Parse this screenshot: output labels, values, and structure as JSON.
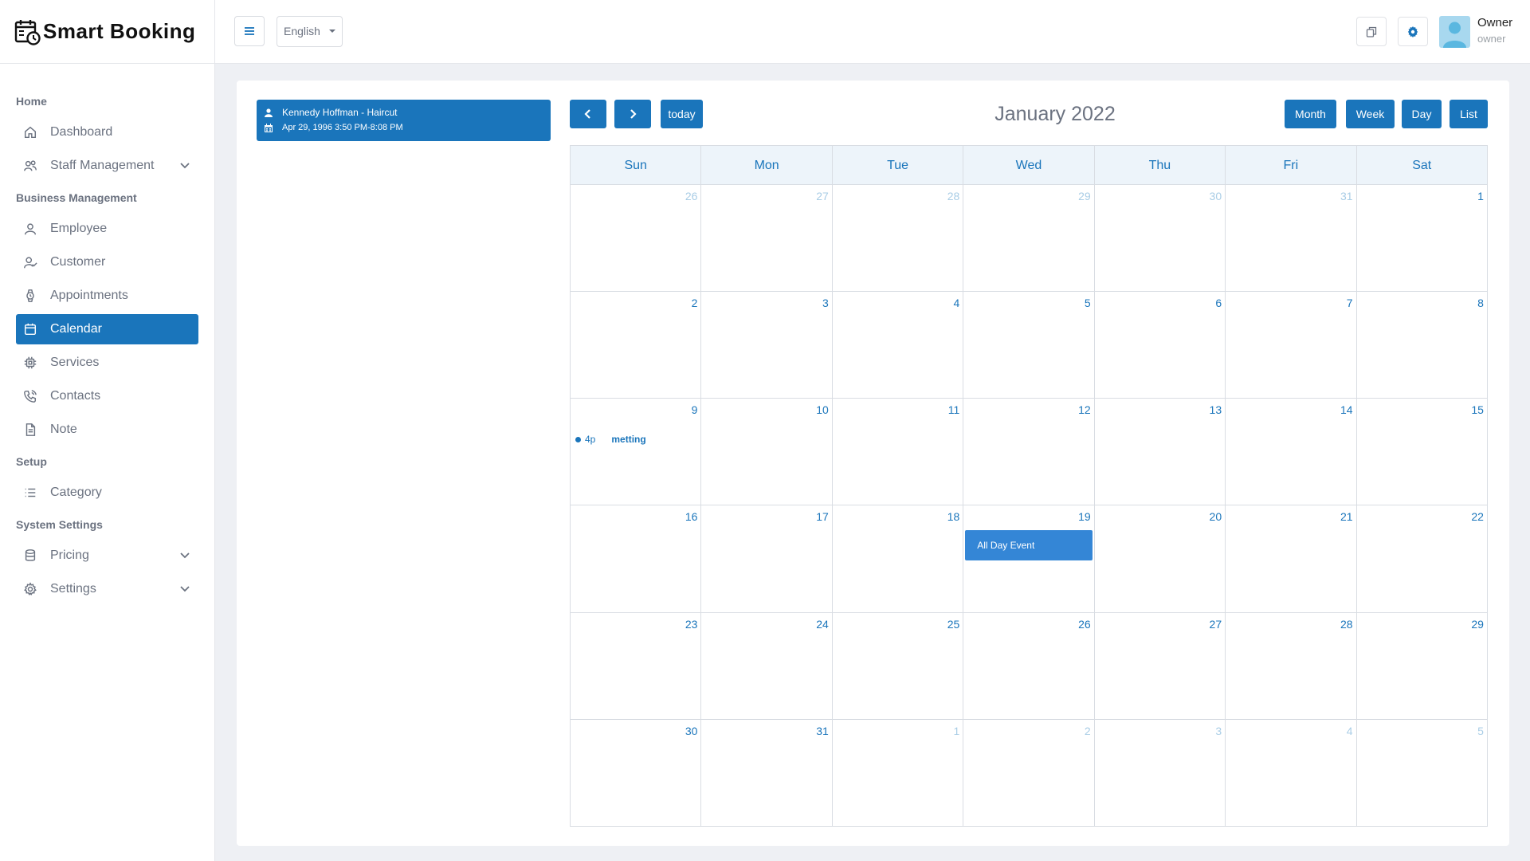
{
  "brand": {
    "name": "Smart Booking"
  },
  "sidebar": {
    "sections": {
      "home": "Home",
      "business": "Business Management",
      "setup": "Setup",
      "system": "System Settings"
    },
    "items": {
      "dashboard": "Dashboard",
      "staff": "Staff Management",
      "employee": "Employee",
      "customer": "Customer",
      "appointments": "Appointments",
      "calendar": "Calendar",
      "services": "Services",
      "contacts": "Contacts",
      "note": "Note",
      "category": "Category",
      "pricing": "Pricing",
      "settings": "Settings"
    },
    "active": "Calendar"
  },
  "header": {
    "language": "English",
    "user": {
      "name": "Owner",
      "role": "owner"
    }
  },
  "external_event": {
    "title": "Kennedy Hoffman - Haircut",
    "datetime": "Apr 29, 1996 3:50 PM-8:08 PM"
  },
  "calendar": {
    "title": "January 2022",
    "today_label": "today",
    "views": {
      "month": "Month",
      "week": "Week",
      "day": "Day",
      "list": "List"
    },
    "days_of_week": [
      "Sun",
      "Mon",
      "Tue",
      "Wed",
      "Thu",
      "Fri",
      "Sat"
    ],
    "weeks": [
      [
        "26",
        "27",
        "28",
        "29",
        "30",
        "31",
        "1"
      ],
      [
        "2",
        "3",
        "4",
        "5",
        "6",
        "7",
        "8"
      ],
      [
        "9",
        "10",
        "11",
        "12",
        "13",
        "14",
        "15"
      ],
      [
        "16",
        "17",
        "18",
        "19",
        "20",
        "21",
        "22"
      ],
      [
        "23",
        "24",
        "25",
        "26",
        "27",
        "28",
        "29"
      ],
      [
        "30",
        "31",
        "1",
        "2",
        "3",
        "4",
        "5"
      ]
    ],
    "events": {
      "meeting": {
        "time": "4p",
        "title": "metting"
      },
      "all_day": {
        "title": "All Day Event"
      }
    }
  },
  "colors": {
    "primary": "#1a75bb",
    "event_blue": "#3486d6",
    "muted_date": "#a9cde6"
  }
}
